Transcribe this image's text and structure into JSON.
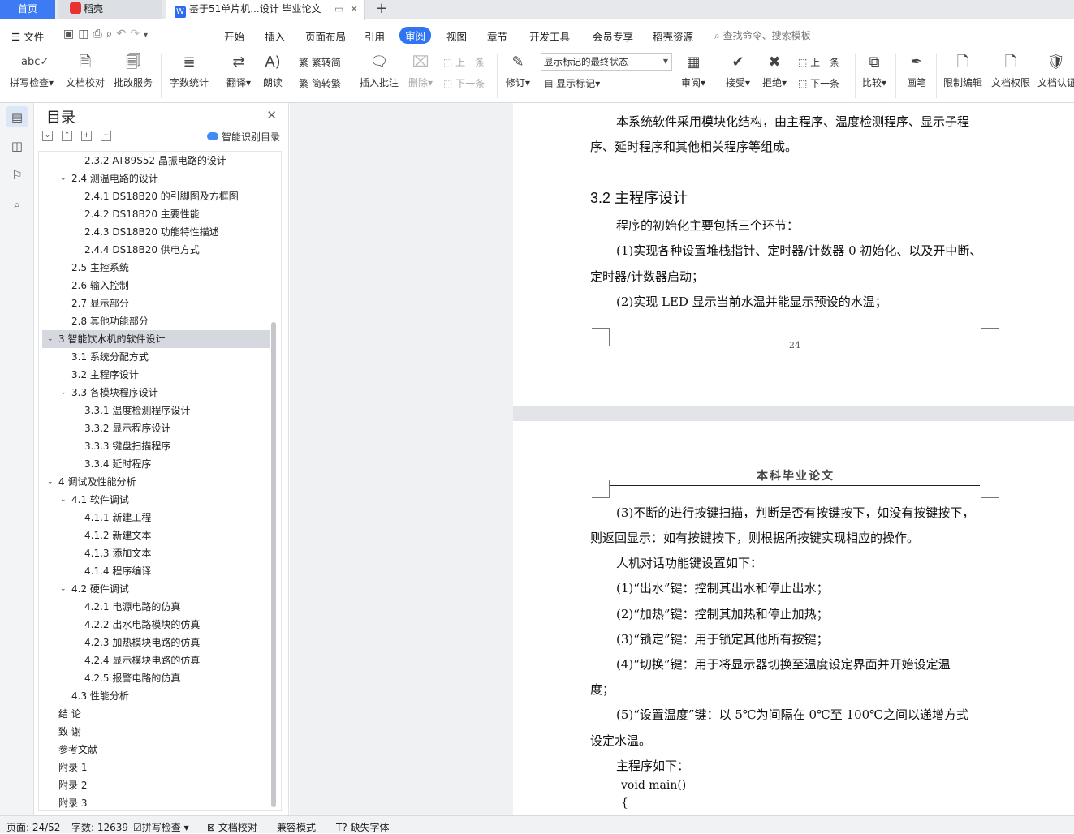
{
  "tabs": {
    "home": "首页",
    "daoke": "稻壳",
    "doc": "基于51单片机...设计 毕业论文"
  },
  "menu": {
    "file": "文件",
    "items": [
      "开始",
      "插入",
      "页面布局",
      "引用",
      "审阅",
      "视图",
      "章节",
      "开发工具",
      "会员专享",
      "稻壳资源"
    ],
    "active": "审阅",
    "search": "查找命令、搜索模板"
  },
  "ribbon": {
    "spell": "拼写检查",
    "proof": "文档校对",
    "batch": "批改服务",
    "wordcount": "字数统计",
    "translate": "翻译",
    "read": "朗读",
    "t2s": "繁转简",
    "s2t": "简转繁",
    "insert_comment": "插入批注",
    "delete": "删除",
    "prev_comment": "上一条",
    "next_comment": "下一条",
    "revise": "修订",
    "show_mode": "显示标记的最终状态",
    "show_markup": "显示标记",
    "review": "审阅",
    "accept": "接受",
    "reject": "拒绝",
    "prev_change": "上一条",
    "next_change": "下一条",
    "compare": "比较",
    "pen": "画笔",
    "restrict": "限制编辑",
    "permission": "文档权限",
    "certify": "文档认证"
  },
  "toc": {
    "title": "目录",
    "smart": "智能识别目录",
    "items": [
      {
        "text": "2.3.2 AT89S52 晶振电路的设计",
        "level": 3,
        "arrow": false
      },
      {
        "text": "2.4  测温电路的设计",
        "level": 2,
        "arrow": true
      },
      {
        "text": "2.4.1 DS18B20 的引脚图及方框图",
        "level": 3,
        "arrow": false
      },
      {
        "text": "2.4.2 DS18B20 主要性能",
        "level": 3,
        "arrow": false
      },
      {
        "text": "2.4.3 DS18B20 功能特性描述",
        "level": 3,
        "arrow": false
      },
      {
        "text": "2.4.4 DS18B20 供电方式",
        "level": 3,
        "arrow": false
      },
      {
        "text": "2.5  主控系统",
        "level": 2,
        "arrow": false
      },
      {
        "text": "2.6  输入控制",
        "level": 2,
        "arrow": false
      },
      {
        "text": "2.7  显示部分",
        "level": 2,
        "arrow": false
      },
      {
        "text": "2.8  其他功能部分",
        "level": 2,
        "arrow": false
      },
      {
        "text": "3  智能饮水机的软件设计",
        "level": 1,
        "arrow": true,
        "selected": true
      },
      {
        "text": "3.1  系统分配方式",
        "level": 2,
        "arrow": false
      },
      {
        "text": "3.2  主程序设计",
        "level": 2,
        "arrow": false
      },
      {
        "text": "3.3  各模块程序设计",
        "level": 2,
        "arrow": true
      },
      {
        "text": "3.3.1  温度检测程序设计",
        "level": 3,
        "arrow": false
      },
      {
        "text": "3.3.2  显示程序设计",
        "level": 3,
        "arrow": false
      },
      {
        "text": "3.3.3  键盘扫描程序",
        "level": 3,
        "arrow": false
      },
      {
        "text": "3.3.4  延时程序",
        "level": 3,
        "arrow": false
      },
      {
        "text": "4  调试及性能分析",
        "level": 1,
        "arrow": true
      },
      {
        "text": "4.1  软件调试",
        "level": 2,
        "arrow": true
      },
      {
        "text": "4.1.1  新建工程",
        "level": 3,
        "arrow": false
      },
      {
        "text": "4.1.2  新建文本",
        "level": 3,
        "arrow": false
      },
      {
        "text": "4.1.3  添加文本",
        "level": 3,
        "arrow": false
      },
      {
        "text": "4.1.4  程序编译",
        "level": 3,
        "arrow": false
      },
      {
        "text": "4.2  硬件调试",
        "level": 2,
        "arrow": true
      },
      {
        "text": "4.2.1  电源电路的仿真",
        "level": 3,
        "arrow": false
      },
      {
        "text": "4.2.2  出水电路模块的仿真",
        "level": 3,
        "arrow": false
      },
      {
        "text": "4.2.3  加热模块电路的仿真",
        "level": 3,
        "arrow": false
      },
      {
        "text": "4.2.4  显示模块电路的仿真",
        "level": 3,
        "arrow": false
      },
      {
        "text": "4.2.5  报警电路的仿真",
        "level": 3,
        "arrow": false
      },
      {
        "text": "4.3  性能分析",
        "level": 2,
        "arrow": false
      },
      {
        "text": "结   论",
        "level": 1,
        "arrow": false
      },
      {
        "text": "致   谢",
        "level": 1,
        "arrow": false
      },
      {
        "text": "参考文献",
        "level": 1,
        "arrow": false
      },
      {
        "text": "附录 1",
        "level": 1,
        "arrow": false
      },
      {
        "text": "附录 2",
        "level": 1,
        "arrow": false
      },
      {
        "text": "附录 3",
        "level": 1,
        "arrow": false
      }
    ]
  },
  "document": {
    "p1_line1": "本系统软件采用模块化结构，由主程序、温度检测程序、显示子程",
    "p1_line2": "序、延时程序和其他相关程序等组成。",
    "heading": "3.2  主程序设计",
    "p2": "程序的初始化主要包括三个环节：",
    "p3_line1": "(1)实现各种设置堆栈指针、定时器/计数器 0 初始化、以及开中断、",
    "p3_line2": "定时器/计数器启动；",
    "p4": "(2)实现 LED 显示当前水温并能显示预设的水温；",
    "page_number": "24",
    "header": "本科毕业论文",
    "q1_line1": "(3)不断的进行按键扫描，判断是否有按键按下，如没有按键按下，",
    "q1_line2": "则返回显示：如有按键按下，则根据所按键实现相应的操作。",
    "q2": "人机对话功能键设置如下：",
    "q3": "(1)“出水”键：控制其出水和停止出水；",
    "q4": "(2)“加热”键：控制其加热和停止加热；",
    "q5": "(3)“锁定”键：用于锁定其他所有按键；",
    "q6_line1": "(4)“切换”键：用于将显示器切换至温度设定界面并开始设定温",
    "q6_line2": "度；",
    "q7_line1": "(5)“设置温度”键：以 5℃为间隔在 0℃至 100℃之间以递增方式",
    "q7_line2": "设定水温。",
    "q8": "主程序如下：",
    "code1": "void main()",
    "code2": "{"
  },
  "status": {
    "page": "页面: 24/52",
    "words": "字数: 12639",
    "spell": "拼写检查",
    "proof": "文档校对",
    "compat": "兼容模式",
    "missing_font": "缺失字体"
  }
}
